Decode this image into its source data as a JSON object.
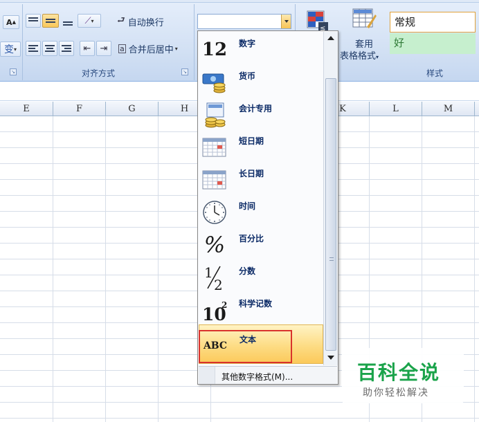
{
  "ribbon": {
    "wrap_text": "自动换行",
    "merge_center": "合并后居中",
    "alignment_group": "对齐方式",
    "format_as_table_line1": "套用",
    "format_as_table_line2": "表格格式",
    "styles_group": "样式",
    "style_normal": "常规",
    "style_good": "好",
    "number_format_value": ""
  },
  "columns": [
    "E",
    "F",
    "G",
    "H",
    "K",
    "L",
    "M"
  ],
  "dropdown": {
    "items": [
      {
        "label": "数字",
        "icon": "number-12-icon",
        "glyph": "12"
      },
      {
        "label": "货币",
        "icon": "currency-icon"
      },
      {
        "label": "会计专用",
        "icon": "accounting-icon"
      },
      {
        "label": "短日期",
        "icon": "short-date-calendar-icon"
      },
      {
        "label": "长日期",
        "icon": "long-date-calendar-icon"
      },
      {
        "label": "时间",
        "icon": "clock-icon"
      },
      {
        "label": "百分比",
        "icon": "percent-icon",
        "glyph": "%"
      },
      {
        "label": "分数",
        "icon": "fraction-icon"
      },
      {
        "label": "科学记数",
        "icon": "scientific-icon"
      },
      {
        "label": "文本",
        "icon": "text-abc-icon",
        "glyph": "ABC"
      }
    ],
    "selected_index": 9,
    "footer": "其他数字格式(M)..."
  },
  "watermark": {
    "title": "百科全说",
    "subtitle": "助你轻松解决"
  },
  "colors": {
    "ribbon_bg": "#d3e1f4",
    "selected_item": "#fddc84",
    "highlight_border": "#d9322c",
    "watermark_green": "#1aa34a"
  }
}
